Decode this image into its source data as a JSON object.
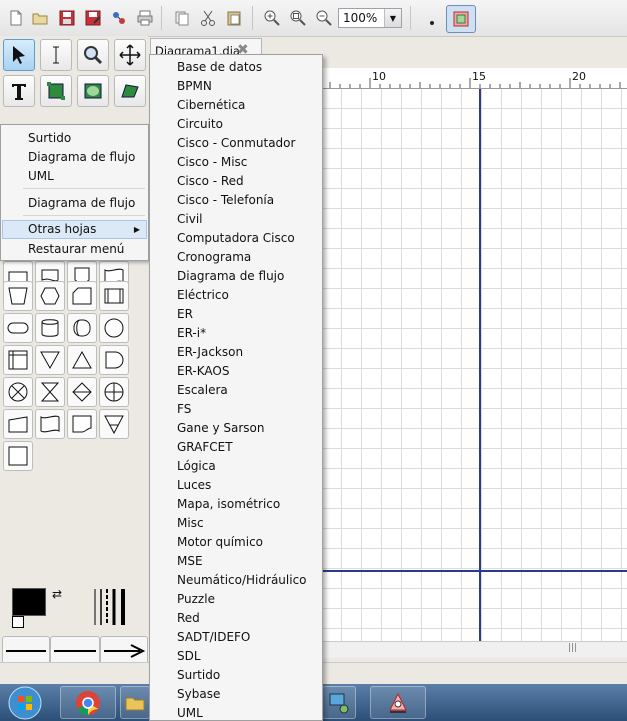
{
  "toolbar": {
    "icons": [
      "new-file-icon",
      "open-file-icon",
      "save-icon",
      "save-as-icon",
      "export-icon",
      "print-icon",
      "copy-icon",
      "cut-icon",
      "paste-icon",
      "zoom-in-icon",
      "zoom-fit-icon",
      "zoom-out-icon"
    ],
    "zoom_value": "100%"
  },
  "tab": {
    "title": "Diagrama1.dia"
  },
  "ruler": {
    "ticks": [
      "10",
      "15",
      "20"
    ]
  },
  "context_menu": {
    "items": [
      {
        "label": "Surtido"
      },
      {
        "label": "Diagrama de flujo"
      },
      {
        "label": "UML"
      },
      {
        "label": "Diagrama de flujo"
      },
      {
        "label": "Otras hojas",
        "has_submenu": true
      },
      {
        "label": "Restaurar menú"
      }
    ]
  },
  "submenu": {
    "items": [
      "Base de datos",
      "BPMN",
      "Cibernética",
      "Circuito",
      "Cisco - Conmutador",
      "Cisco - Misc",
      "Cisco - Red",
      "Cisco - Telefonía",
      "Civil",
      "Computadora Cisco",
      "Cronograma",
      "Diagrama de flujo",
      "Eléctrico",
      "ER",
      "ER-i*",
      "ER-Jackson",
      "ER-KAOS",
      "Escalera",
      "FS",
      "Gane y Sarson",
      "GRAFCET",
      "Lógica",
      "Luces",
      "Mapa, isométrico",
      "Misc",
      "Motor químico",
      "MSE",
      "Neumático/Hidráulico",
      "Puzzle",
      "Red",
      "SADT/IDEFO",
      "SDL",
      "Surtido",
      "Sybase",
      "UML"
    ]
  },
  "colors": {
    "guide": "#2a3b8f",
    "menu_hover": "#dbe8f6",
    "foreground": "#000000",
    "background": "#ffffff"
  }
}
